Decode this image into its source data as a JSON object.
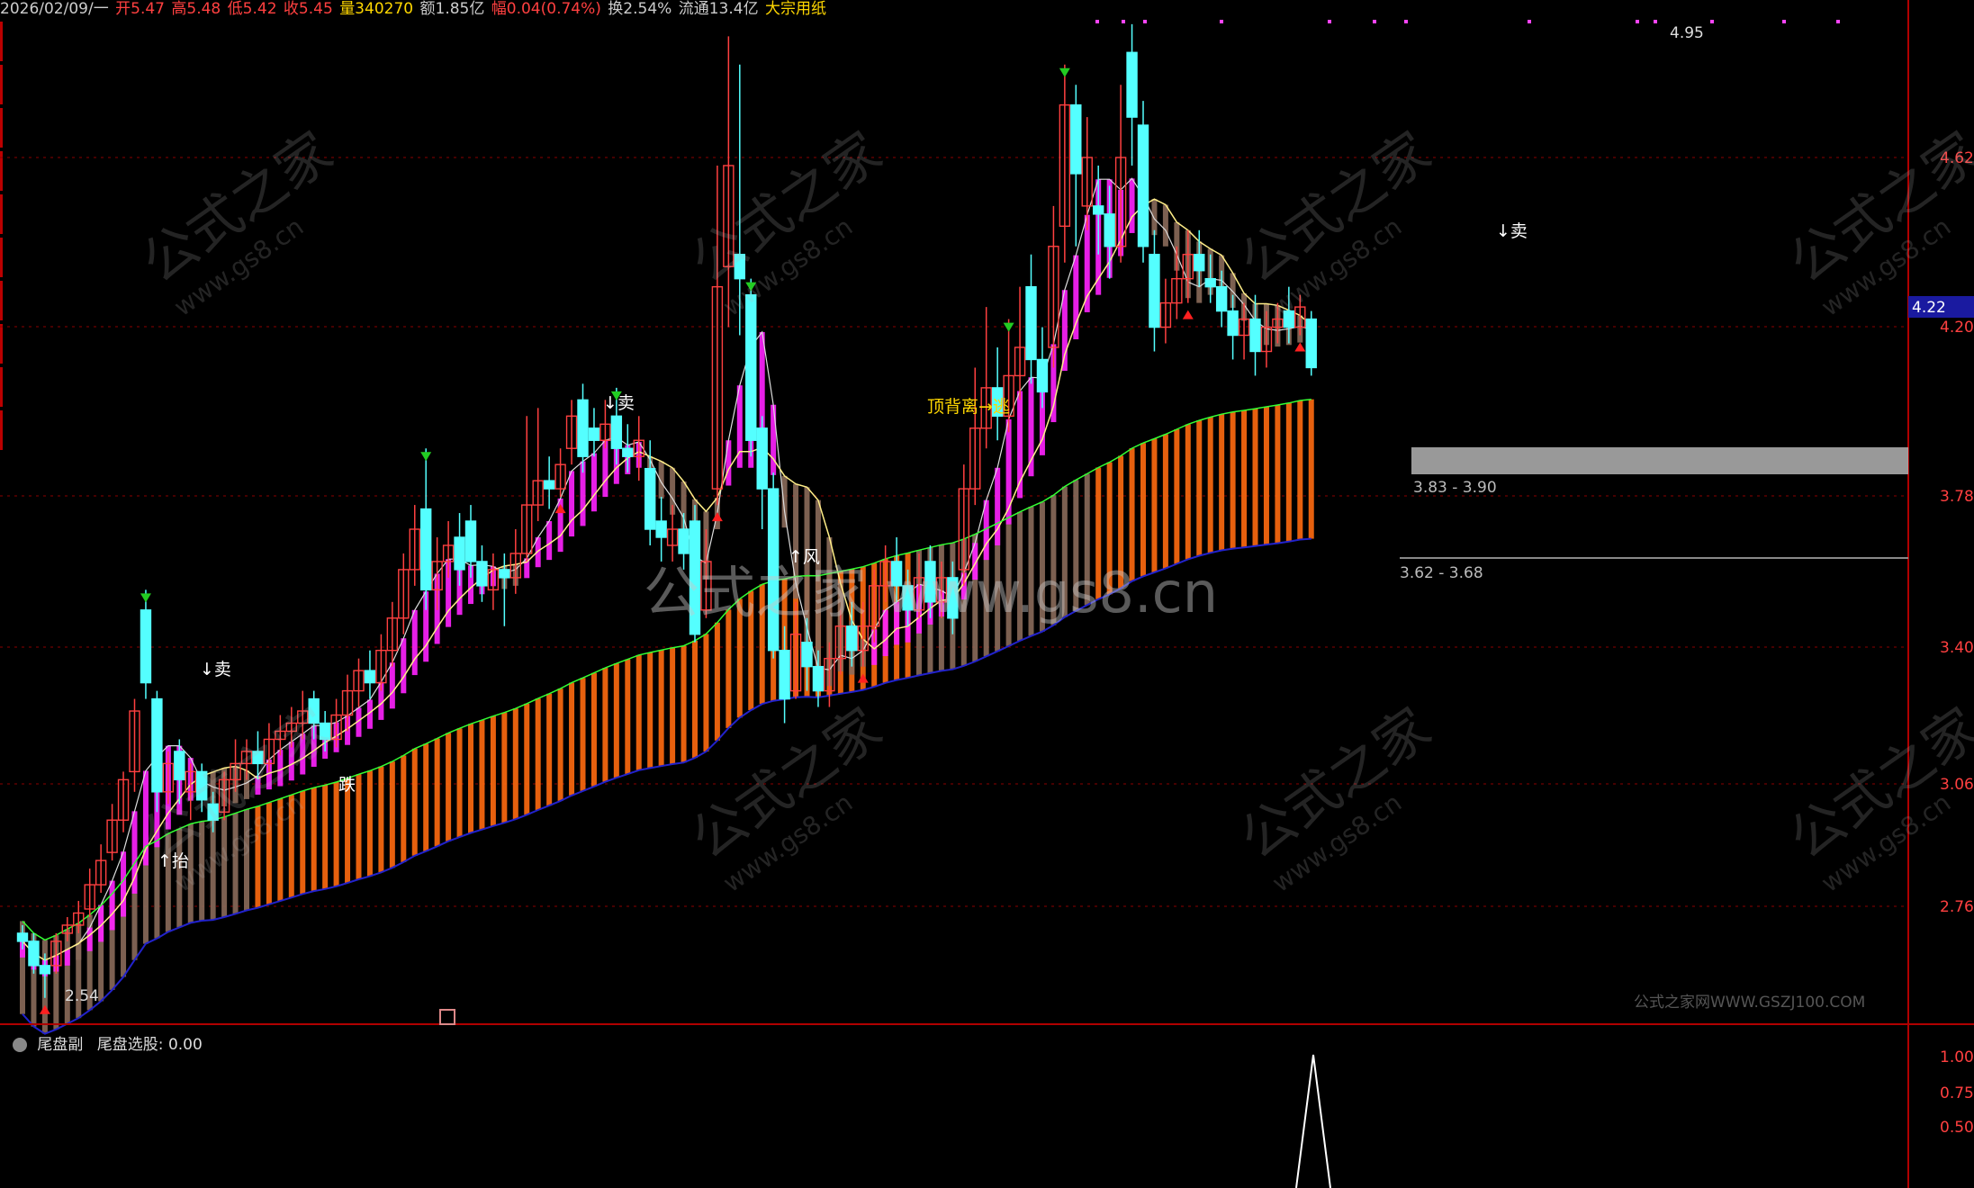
{
  "header": {
    "date": "2026/02/09/一",
    "open": "开5.47",
    "high": "高5.48",
    "low": "低5.42",
    "close": "收5.45",
    "volume": "量340270",
    "amount": "额1.85亿",
    "change": "幅0.04(0.74%)",
    "turnover": "换2.54%",
    "float": "流通13.4亿",
    "sector": "大宗用纸"
  },
  "colors": {
    "up": "#ff4040",
    "down": "#54ffff",
    "magenta_band": "#ff22ff",
    "orange_band": "#ff6a10",
    "brown_band": "#8a6a5a",
    "grid": "#8b0000",
    "axis": "#b00000"
  },
  "chart_data": {
    "type": "candlestick",
    "y_ticks": [
      "4.62",
      "4.20",
      "3.78",
      "3.40",
      "3.06",
      "2.76"
    ],
    "price_tag": "4.22",
    "annotations": {
      "high_label": "4.95",
      "low_label": "2.54",
      "range_label_1": "3.83 - 3.90",
      "range_label_2": "3.62 - 3.68",
      "top_divergence": "顶背离→逃",
      "sell_1": "↓卖",
      "sell_2": "↓卖",
      "sell_3": "↓卖",
      "lift": "↑抬",
      "fall": "跌",
      "wind": "↑风",
      "footer_site": "公式之家网WWW.GSZJ100.COM",
      "center_watermark": "公式之家 www.gs8.cn"
    },
    "candles": [
      [
        2.7,
        2.68,
        2.72,
        2.66
      ],
      [
        2.68,
        2.62,
        2.7,
        2.6
      ],
      [
        2.62,
        2.6,
        2.65,
        2.54
      ],
      [
        2.62,
        2.68,
        2.7,
        2.6
      ],
      [
        2.7,
        2.72,
        2.74,
        2.68
      ],
      [
        2.72,
        2.75,
        2.78,
        2.7
      ],
      [
        2.76,
        2.82,
        2.86,
        2.74
      ],
      [
        2.82,
        2.88,
        2.92,
        2.8
      ],
      [
        2.9,
        2.98,
        3.02,
        2.88
      ],
      [
        2.98,
        3.08,
        3.1,
        2.95
      ],
      [
        3.1,
        3.25,
        3.28,
        3.05
      ],
      [
        3.5,
        3.32,
        3.55,
        3.28
      ],
      [
        3.28,
        3.05,
        3.3,
        3.0
      ],
      [
        3.05,
        3.12,
        3.15,
        3.02
      ],
      [
        3.15,
        3.08,
        3.18,
        3.02
      ],
      [
        3.05,
        3.1,
        3.12,
        2.98
      ],
      [
        3.1,
        3.03,
        3.12,
        3.0
      ],
      [
        3.02,
        2.98,
        3.05,
        2.95
      ],
      [
        3.0,
        3.08,
        3.1,
        2.98
      ],
      [
        3.08,
        3.12,
        3.18,
        3.05
      ],
      [
        3.12,
        3.15,
        3.18,
        3.08
      ],
      [
        3.15,
        3.12,
        3.2,
        3.08
      ],
      [
        3.12,
        3.18,
        3.22,
        3.1
      ],
      [
        3.18,
        3.2,
        3.24,
        3.14
      ],
      [
        3.2,
        3.22,
        3.26,
        3.16
      ],
      [
        3.22,
        3.25,
        3.3,
        3.18
      ],
      [
        3.28,
        3.22,
        3.3,
        3.18
      ],
      [
        3.22,
        3.18,
        3.25,
        3.15
      ],
      [
        3.18,
        3.24,
        3.28,
        3.16
      ],
      [
        3.24,
        3.3,
        3.34,
        3.2
      ],
      [
        3.3,
        3.35,
        3.38,
        3.26
      ],
      [
        3.35,
        3.32,
        3.4,
        3.28
      ],
      [
        3.32,
        3.4,
        3.44,
        3.3
      ],
      [
        3.4,
        3.48,
        3.52,
        3.36
      ],
      [
        3.48,
        3.6,
        3.64,
        3.44
      ],
      [
        3.6,
        3.7,
        3.76,
        3.56
      ],
      [
        3.75,
        3.55,
        3.9,
        3.5
      ],
      [
        3.55,
        3.62,
        3.68,
        3.5
      ],
      [
        3.62,
        3.66,
        3.72,
        3.58
      ],
      [
        3.68,
        3.6,
        3.74,
        3.56
      ],
      [
        3.72,
        3.62,
        3.76,
        3.58
      ],
      [
        3.62,
        3.56,
        3.66,
        3.52
      ],
      [
        3.55,
        3.6,
        3.64,
        3.5
      ],
      [
        3.6,
        3.58,
        3.64,
        3.46
      ],
      [
        3.58,
        3.64,
        3.7,
        3.54
      ],
      [
        3.64,
        3.76,
        3.98,
        3.62
      ],
      [
        3.76,
        3.82,
        4.0,
        3.72
      ],
      [
        3.82,
        3.8,
        3.88,
        3.75
      ],
      [
        3.8,
        3.86,
        3.9,
        3.78
      ],
      [
        3.9,
        3.98,
        4.02,
        3.86
      ],
      [
        4.02,
        3.88,
        4.06,
        3.84
      ],
      [
        3.95,
        3.92,
        4.0,
        3.88
      ],
      [
        3.92,
        3.96,
        4.02,
        3.9
      ],
      [
        3.98,
        3.9,
        4.05,
        3.86
      ],
      [
        3.9,
        3.88,
        3.96,
        3.84
      ],
      [
        3.88,
        3.92,
        3.98,
        3.82
      ],
      [
        3.85,
        3.7,
        3.92,
        3.66
      ],
      [
        3.72,
        3.68,
        3.78,
        3.62
      ],
      [
        3.66,
        3.7,
        3.76,
        3.62
      ],
      [
        3.7,
        3.64,
        3.74,
        3.6
      ],
      [
        3.72,
        3.44,
        3.76,
        3.42
      ],
      [
        3.5,
        3.62,
        3.7,
        3.48
      ],
      [
        3.8,
        4.3,
        4.6,
        3.76
      ],
      [
        4.35,
        4.6,
        4.92,
        4.2
      ],
      [
        4.38,
        4.32,
        4.85,
        4.18
      ],
      [
        4.28,
        3.92,
        4.32,
        3.88
      ],
      [
        3.95,
        3.8,
        3.98,
        3.7
      ],
      [
        3.8,
        3.4,
        3.84,
        3.38
      ],
      [
        3.4,
        3.28,
        3.46,
        3.22
      ],
      [
        3.3,
        3.44,
        3.52,
        3.28
      ],
      [
        3.42,
        3.36,
        3.48,
        3.3
      ],
      [
        3.36,
        3.3,
        3.4,
        3.26
      ],
      [
        3.3,
        3.38,
        3.42,
        3.26
      ],
      [
        3.38,
        3.46,
        3.5,
        3.34
      ],
      [
        3.46,
        3.4,
        3.52,
        3.36
      ],
      [
        3.4,
        3.46,
        3.52,
        3.36
      ],
      [
        3.46,
        3.56,
        3.6,
        3.42
      ],
      [
        3.56,
        3.62,
        3.66,
        3.52
      ],
      [
        3.62,
        3.56,
        3.68,
        3.52
      ],
      [
        3.56,
        3.5,
        3.6,
        3.46
      ],
      [
        3.5,
        3.58,
        3.64,
        3.48
      ],
      [
        3.62,
        3.52,
        3.66,
        3.48
      ],
      [
        3.52,
        3.58,
        3.62,
        3.48
      ],
      [
        3.58,
        3.48,
        3.62,
        3.44
      ],
      [
        3.6,
        3.8,
        3.86,
        3.56
      ],
      [
        3.8,
        3.95,
        4.1,
        3.76
      ],
      [
        3.95,
        4.05,
        4.25,
        3.9
      ],
      [
        4.05,
        3.98,
        4.15,
        3.92
      ],
      [
        3.98,
        4.08,
        4.22,
        3.94
      ],
      [
        4.08,
        4.15,
        4.3,
        4.02
      ],
      [
        4.3,
        4.12,
        4.38,
        4.06
      ],
      [
        4.12,
        4.04,
        4.2,
        4.0
      ],
      [
        4.15,
        4.4,
        4.5,
        4.1
      ],
      [
        4.45,
        4.75,
        4.85,
        4.36
      ],
      [
        4.75,
        4.58,
        4.8,
        4.4
      ],
      [
        4.5,
        4.62,
        4.72,
        4.44
      ],
      [
        4.5,
        4.48,
        4.6,
        4.38
      ],
      [
        4.48,
        4.4,
        4.55,
        4.32
      ],
      [
        4.4,
        4.62,
        4.8,
        4.36
      ],
      [
        4.88,
        4.72,
        4.95,
        4.6
      ],
      [
        4.7,
        4.4,
        4.76,
        4.36
      ],
      [
        4.38,
        4.2,
        4.44,
        4.14
      ],
      [
        4.2,
        4.26,
        4.32,
        4.16
      ],
      [
        4.26,
        4.32,
        4.4,
        4.22
      ],
      [
        4.32,
        4.38,
        4.44,
        4.26
      ],
      [
        4.38,
        4.34,
        4.44,
        4.3
      ],
      [
        4.32,
        4.3,
        4.38,
        4.26
      ],
      [
        4.3,
        4.24,
        4.34,
        4.2
      ],
      [
        4.24,
        4.18,
        4.28,
        4.12
      ],
      [
        4.18,
        4.22,
        4.26,
        4.12
      ],
      [
        4.22,
        4.14,
        4.28,
        4.08
      ],
      [
        4.14,
        4.2,
        4.24,
        4.1
      ],
      [
        4.2,
        4.22,
        4.26,
        4.16
      ],
      [
        4.24,
        4.2,
        4.3,
        4.16
      ],
      [
        4.2,
        4.25,
        4.28,
        4.18
      ],
      [
        4.22,
        4.1,
        4.24,
        4.08
      ]
    ],
    "sub_panel": {
      "title": "尾盘副",
      "label": "尾盘选股: 0.00",
      "y_ticks": [
        "1.00",
        "0.75",
        "0.50"
      ]
    }
  }
}
